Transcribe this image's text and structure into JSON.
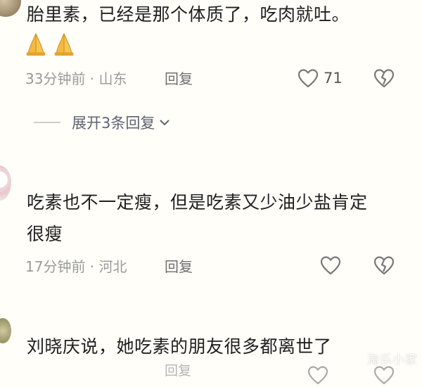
{
  "comments": [
    {
      "text": "胎里素，已经是那个体质了，吃肉就吐。",
      "emojis": [
        "folded-hands",
        "folded-hands"
      ],
      "time_location": "33分钟前 · 山东",
      "reply_label": "回复",
      "likes": "71",
      "expand_label": "展开3条回复"
    },
    {
      "text_line1": "吃素也不一定瘦，但是吃素又少油少盐肯定",
      "text_line2": "很瘦",
      "time_location": "17分钟前 · 河北",
      "reply_label": "回复"
    },
    {
      "text": "刘晓庆说，她吃素的朋友很多都离世了",
      "reply_label": "回复"
    }
  ],
  "watermark": "淘乐小家",
  "colors": {
    "background": "#fffef9",
    "meta": "#9a9a9a",
    "link": "#5d6470"
  }
}
